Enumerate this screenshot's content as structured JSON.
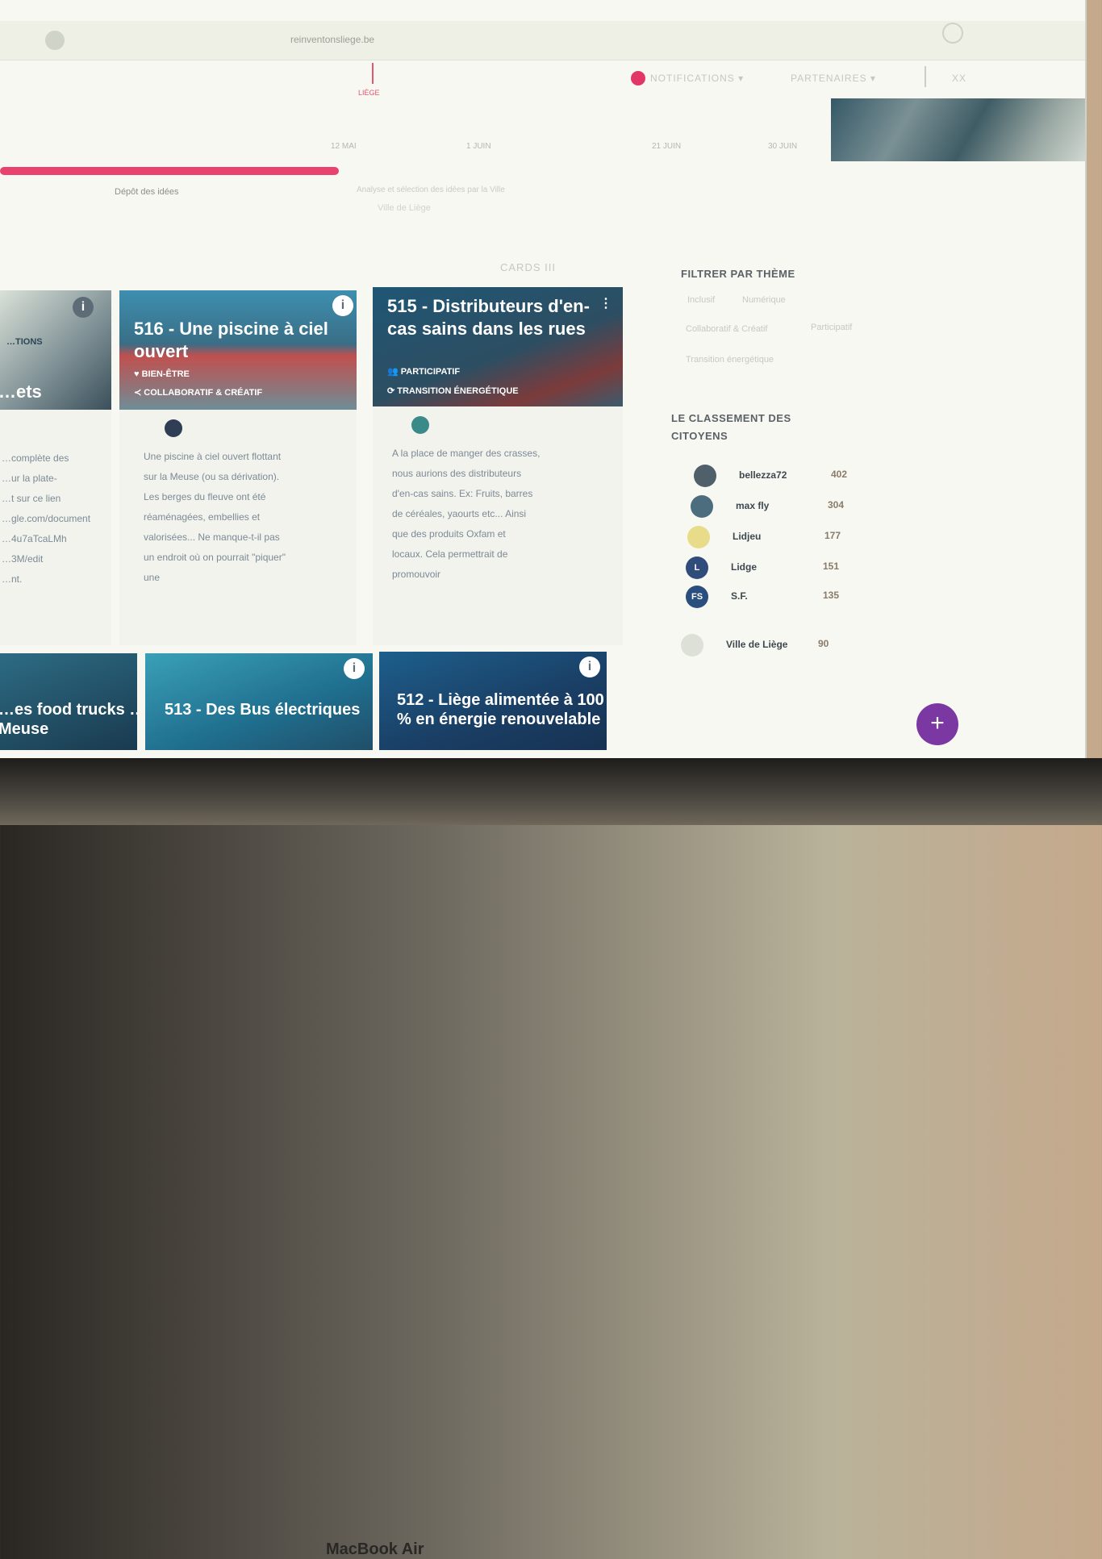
{
  "browser": {
    "url": "reinventonsliege.be"
  },
  "header": {
    "logo_text": "LIÈGE",
    "nav": [
      "NOTIFICATIONS ▾",
      "PARTENAIRES ▾"
    ],
    "user_label": "XX"
  },
  "timeline": {
    "dates": [
      "12 MAI",
      "1 JUIN",
      "21 JUIN",
      "30 JUIN"
    ],
    "progress_percent": 42,
    "current_step": "Dépôt des idées",
    "next_step_desc": "Analyse et sélection des idées par la Ville",
    "link": "Ville de Liège"
  },
  "cards_heading": "CARDS III",
  "cards": [
    {
      "title": "…ets",
      "meta_top": "…TIONS",
      "text": [
        "…complète des",
        "…ur la plate-",
        "…t sur ce lien",
        "…gle.com/document",
        "…4u7aTcaLMh",
        "…3M/edit",
        "…nt."
      ]
    },
    {
      "title": "516 - Une piscine à ciel ouvert",
      "meta_top": "♥ BIEN-ÊTRE",
      "meta_bottom": "≺ COLLABORATIF & CRÉATIF",
      "text": [
        "Une piscine à ciel ouvert flottant",
        "sur la Meuse (ou sa dérivation).",
        "",
        "Les berges du fleuve ont été",
        "réaménagées, embellies et",
        "valorisées... Ne manque-t-il pas",
        "un endroit où on pourrait \"piquer\"",
        "une"
      ]
    },
    {
      "title": "515 - Distributeurs d'en-cas sains dans les rues",
      "meta_top": "👥 PARTICIPATIF",
      "meta_bottom": "⟳ TRANSITION ÉNERGÉTIQUE",
      "text": [
        "A la place de manger des crasses,",
        "nous aurions des distributeurs",
        "d'en-cas sains. Ex: Fruits, barres",
        "de céréales, yaourts etc... Ainsi",
        "que des produits Oxfam et",
        "locaux. Cela permettrait de",
        "promouvoir"
      ]
    }
  ],
  "cards_row2": [
    {
      "title": "…es food trucks …de la Meuse"
    },
    {
      "title": "513 - Des Bus électriques"
    },
    {
      "title": "512 - Liège alimentée à 100 % en énergie renouvelable"
    }
  ],
  "sidebar": {
    "filter_title": "FILTRER PAR THÈME",
    "themes": [
      "Inclusif",
      "Numérique",
      "Collaboratif & Créatif",
      "Participatif",
      "Transition énergétique"
    ],
    "ranking_title": "LE CLASSEMENT DES CITOYENS",
    "ranking": [
      {
        "name": "bellezza72",
        "score": "402",
        "initials": "",
        "color": "#50606a"
      },
      {
        "name": "max fly",
        "score": "304",
        "initials": "",
        "color": "#4b6d7d"
      },
      {
        "name": "Lidjeu",
        "score": "177",
        "initials": "",
        "color": "#e8dc8a"
      },
      {
        "name": "Lidge",
        "score": "151",
        "initials": "L",
        "color": "#2f4c7a"
      },
      {
        "name": "S.F.",
        "score": "135",
        "initials": "FS",
        "color": "#2a4e7e"
      },
      {
        "name": "Ville de Liège",
        "score": "90",
        "initials": "",
        "color": "#dde0d6"
      }
    ]
  },
  "fab_label": "+",
  "device_brand": "MacBook Air"
}
